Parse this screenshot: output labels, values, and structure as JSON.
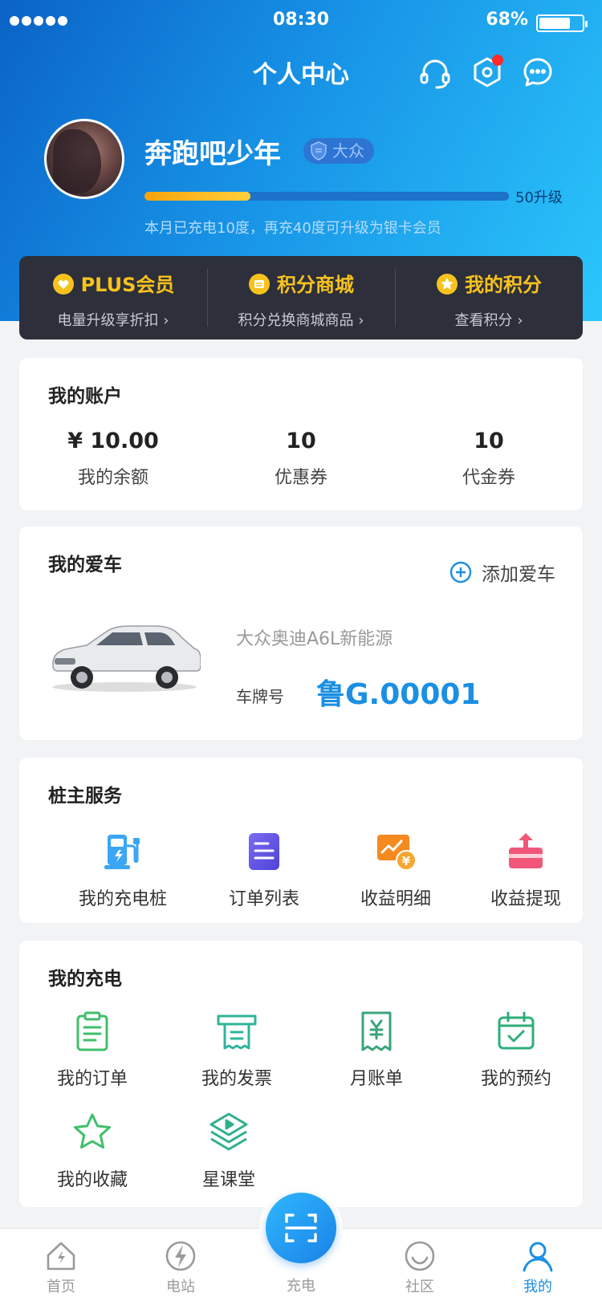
{
  "status_bar": {
    "time": "08:30",
    "battery_percent": "68%",
    "battery_level": 0.68
  },
  "header": {
    "title": "个人中心",
    "icons": [
      "headset-icon",
      "settings-icon",
      "message-icon"
    ],
    "settings_has_notification": true
  },
  "profile": {
    "username": "奔跑吧少年",
    "level_badge": "大众",
    "progress_fraction": 0.29,
    "progress_label": "50升级",
    "hint": "本月已充电10度，再充40度可升级为银卡会员"
  },
  "member_bar": [
    {
      "title": "PLUS会员",
      "subtitle": "电量升级享折扣 ›",
      "icon": "heart-badge-icon"
    },
    {
      "title": "积分商城",
      "subtitle": "积分兑换商城商品 ›",
      "icon": "store-icon"
    },
    {
      "title": "我的积分",
      "subtitle": "查看积分 ›",
      "icon": "star-badge-icon"
    }
  ],
  "account": {
    "title": "我的账户",
    "items": [
      {
        "value": "¥  10.00",
        "label": "我的余额"
      },
      {
        "value": "10",
        "label": "优惠券"
      },
      {
        "value": "10",
        "label": "代金券"
      }
    ]
  },
  "car": {
    "title": "我的爱车",
    "add_label": "添加爱车",
    "model": "大众奥迪A6L新能源",
    "plate_label": "车牌号",
    "plate": "鲁G.00001"
  },
  "owner_services": {
    "title": "桩主服务",
    "items": [
      {
        "label": "我的充电桩",
        "icon": "charging-pile-icon"
      },
      {
        "label": "订单列表",
        "icon": "order-list-icon"
      },
      {
        "label": "收益明细",
        "icon": "income-detail-icon"
      },
      {
        "label": "收益提现",
        "icon": "withdraw-icon"
      }
    ]
  },
  "my_charging": {
    "title": "我的充电",
    "items": [
      {
        "label": "我的订单",
        "icon": "clipboard-icon"
      },
      {
        "label": "我的发票",
        "icon": "invoice-icon"
      },
      {
        "label": "月账单",
        "icon": "bill-icon"
      },
      {
        "label": "我的预约",
        "icon": "calendar-icon"
      },
      {
        "label": "我的收藏",
        "icon": "star-icon"
      },
      {
        "label": "星课堂",
        "icon": "course-icon"
      }
    ]
  },
  "tabbar": {
    "items": [
      {
        "label": "首页",
        "icon": "home-icon"
      },
      {
        "label": "电站",
        "icon": "station-icon"
      },
      {
        "label": "充电",
        "icon": "scan-icon"
      },
      {
        "label": "社区",
        "icon": "community-icon"
      },
      {
        "label": "我的",
        "icon": "profile-icon"
      }
    ],
    "active": "我的"
  },
  "colors": {
    "accent": "#1a8fe3",
    "gold": "#f6c21d",
    "member_bar_bg": "#2d2f3b"
  }
}
